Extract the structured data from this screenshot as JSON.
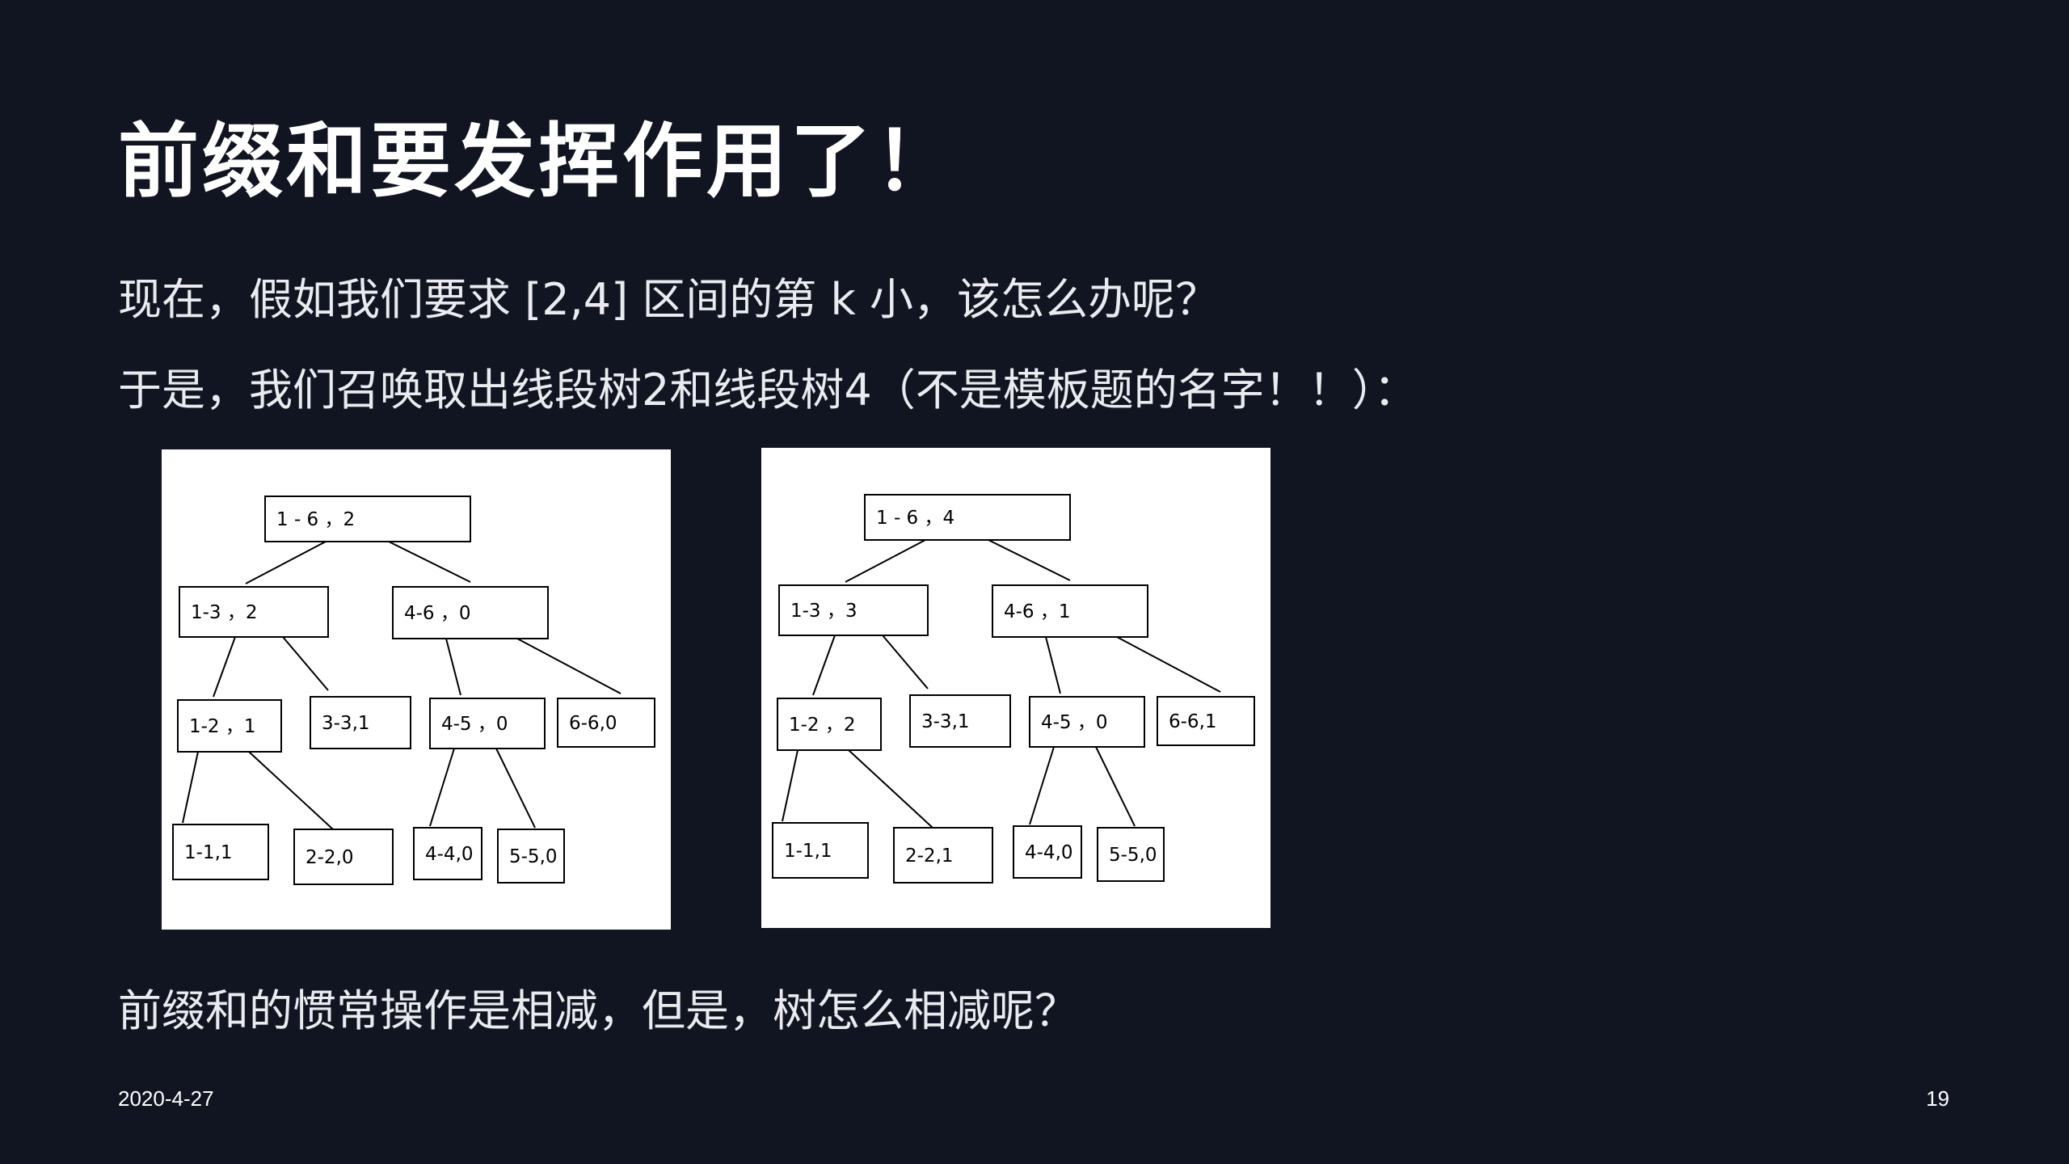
{
  "slide": {
    "title": "前缀和要发挥作用了！",
    "line1": "现在，假如我们要求 [2,4] 区间的第 k 小，该怎么办呢？",
    "line2": "于是，我们召唤取出线段树2和线段树4（不是模板题的名字！！）：",
    "line3": "前缀和的惯常操作是相减，但是，树怎么相减呢？",
    "date": "2020-4-27",
    "page_number": "19"
  },
  "trees": [
    {
      "name": "线段树2",
      "nodes": [
        {
          "range": "1 - 6",
          "sep": "，",
          "count": "2"
        },
        {
          "range": "1-3",
          "sep": "，",
          "count": "2"
        },
        {
          "range": "4-6",
          "sep": "，",
          "count": "0"
        },
        {
          "range": "1-2",
          "sep": "，",
          "count": "1"
        },
        {
          "range": "3-3,",
          "sep": "",
          "count": "1"
        },
        {
          "range": "4-5",
          "sep": "，",
          "count": "0"
        },
        {
          "range": "6-6,",
          "sep": "",
          "count": "0"
        },
        {
          "range": "1-1,",
          "sep": "",
          "count": "1"
        },
        {
          "range": "2-2,",
          "sep": "",
          "count": "0"
        },
        {
          "range": "4-4,",
          "sep": "",
          "count": "0"
        },
        {
          "range": "5-5,",
          "sep": "",
          "count": "0"
        }
      ]
    },
    {
      "name": "线段树4",
      "nodes": [
        {
          "range": "1 - 6",
          "sep": "，",
          "count": "4"
        },
        {
          "range": "1-3",
          "sep": "，",
          "count": "3"
        },
        {
          "range": "4-6",
          "sep": "，",
          "count": "1"
        },
        {
          "range": "1-2",
          "sep": "，",
          "count": "2"
        },
        {
          "range": "3-3,",
          "sep": "",
          "count": "1"
        },
        {
          "range": "4-5",
          "sep": "，",
          "count": "0"
        },
        {
          "range": "6-6,",
          "sep": "",
          "count": "1"
        },
        {
          "range": "1-1,",
          "sep": "",
          "count": "1"
        },
        {
          "range": "2-2,",
          "sep": "",
          "count": "1"
        },
        {
          "range": "4-4,",
          "sep": "",
          "count": "0"
        },
        {
          "range": "5-5,",
          "sep": "",
          "count": "0"
        }
      ]
    }
  ]
}
